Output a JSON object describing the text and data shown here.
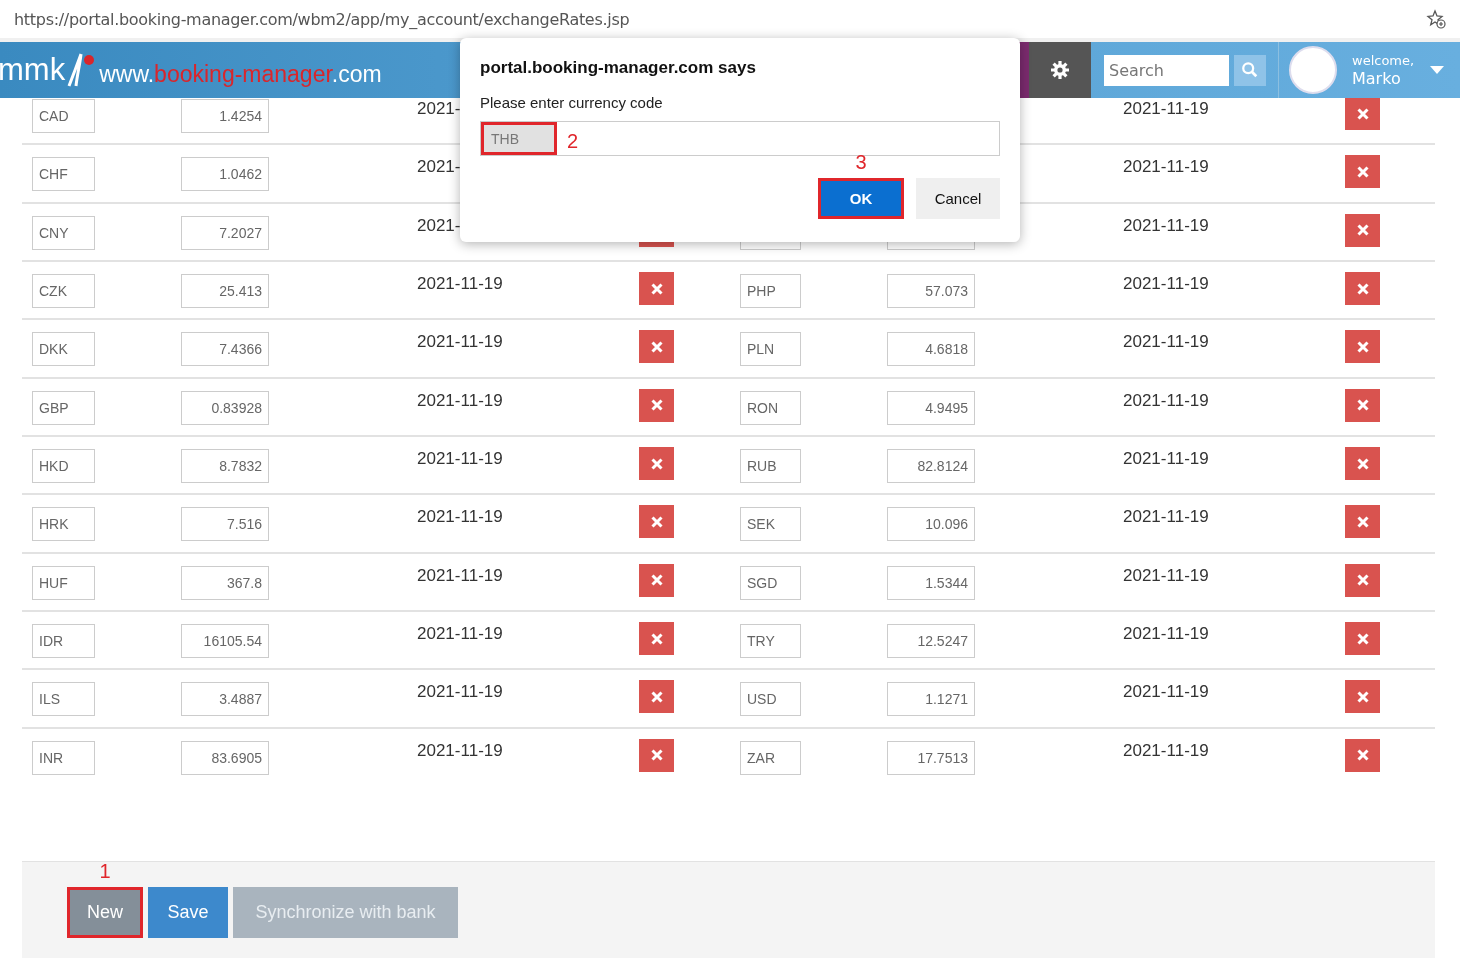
{
  "browser": {
    "url": "https://portal.booking-manager.com/wbm2/app/my_account/exchangeRates.jsp"
  },
  "header": {
    "logo_text": "mmk",
    "site": [
      {
        "text": "www.",
        "highlight": false
      },
      {
        "text": "booking-manager",
        "highlight": true
      },
      {
        "text": ".com",
        "highlight": false
      }
    ],
    "search": {
      "placeholder": "Search"
    },
    "user": {
      "greeting": "welcome,",
      "name": "Marko"
    }
  },
  "rates": [
    {
      "left": {
        "code": "CAD",
        "rate": "1.4254",
        "date": "2021-"
      },
      "right": {
        "date": "2021-11-19"
      }
    },
    {
      "left": {
        "code": "CHF",
        "rate": "1.0462",
        "date": "2021-"
      },
      "right": {
        "date": "2021-11-19"
      }
    },
    {
      "left": {
        "code": "CNY",
        "rate": "7.2027",
        "date": "2021-"
      },
      "right": {
        "date": "2021-11-19"
      }
    },
    {
      "left": {
        "code": "CZK",
        "rate": "25.413",
        "date": "2021-11-19"
      },
      "right": {
        "code": "PHP",
        "rate": "57.073",
        "date": "2021-11-19"
      }
    },
    {
      "left": {
        "code": "DKK",
        "rate": "7.4366",
        "date": "2021-11-19"
      },
      "right": {
        "code": "PLN",
        "rate": "4.6818",
        "date": "2021-11-19"
      }
    },
    {
      "left": {
        "code": "GBP",
        "rate": "0.83928",
        "date": "2021-11-19"
      },
      "right": {
        "code": "RON",
        "rate": "4.9495",
        "date": "2021-11-19"
      }
    },
    {
      "left": {
        "code": "HKD",
        "rate": "8.7832",
        "date": "2021-11-19"
      },
      "right": {
        "code": "RUB",
        "rate": "82.8124",
        "date": "2021-11-19"
      }
    },
    {
      "left": {
        "code": "HRK",
        "rate": "7.516",
        "date": "2021-11-19"
      },
      "right": {
        "code": "SEK",
        "rate": "10.096",
        "date": "2021-11-19"
      }
    },
    {
      "left": {
        "code": "HUF",
        "rate": "367.8",
        "date": "2021-11-19"
      },
      "right": {
        "code": "SGD",
        "rate": "1.5344",
        "date": "2021-11-19"
      }
    },
    {
      "left": {
        "code": "IDR",
        "rate": "16105.54",
        "date": "2021-11-19"
      },
      "right": {
        "code": "TRY",
        "rate": "12.5247",
        "date": "2021-11-19"
      }
    },
    {
      "left": {
        "code": "ILS",
        "rate": "3.4887",
        "date": "2021-11-19"
      },
      "right": {
        "code": "USD",
        "rate": "1.1271",
        "date": "2021-11-19"
      }
    },
    {
      "left": {
        "code": "INR",
        "rate": "83.6905",
        "date": "2021-11-19"
      },
      "right": {
        "code": "ZAR",
        "rate": "17.7513",
        "date": "2021-11-19"
      }
    }
  ],
  "buttons": [
    {
      "label": "New",
      "kind": "default",
      "highlighted": true,
      "marker": "1"
    },
    {
      "label": "Save",
      "kind": "primary",
      "highlighted": false
    },
    {
      "label": "Synchronize with bank",
      "kind": "disabled",
      "highlighted": false
    }
  ],
  "dialog": {
    "title": "portal.booking-manager.com says",
    "message": "Please enter currency code",
    "input": {
      "value": "THB",
      "highlighted": true,
      "marker": "2"
    },
    "buttons": [
      {
        "label": "OK",
        "kind": "primary",
        "highlighted": true,
        "marker": "3"
      },
      {
        "label": "Cancel",
        "kind": "secondary",
        "highlighted": false
      }
    ]
  }
}
